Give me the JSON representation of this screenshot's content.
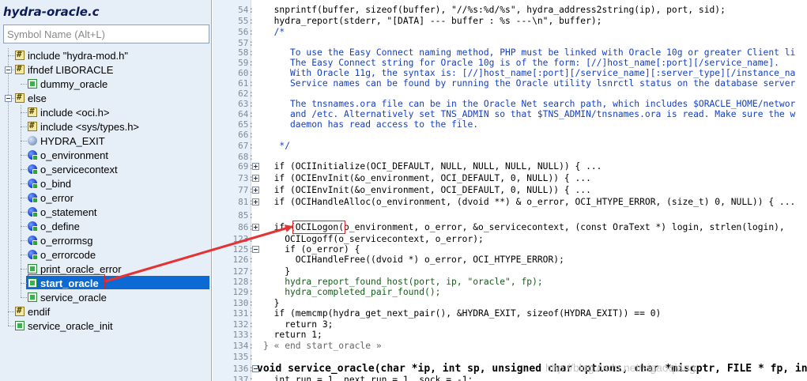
{
  "sidebar": {
    "file_title": "hydra-oracle.c",
    "search_placeholder": "Symbol Name (Alt+L)",
    "items": [
      {
        "label": "include \"hydra-mod.h\"",
        "icon": "include-icon"
      },
      {
        "label": "ifndef LIBORACLE",
        "icon": "conditional-icon"
      },
      {
        "label": "dummy_oracle",
        "icon": "function-icon"
      },
      {
        "label": "else",
        "icon": "conditional-icon"
      },
      {
        "label": "include <oci.h>",
        "icon": "include-icon"
      },
      {
        "label": "include <sys/types.h>",
        "icon": "include-icon"
      },
      {
        "label": "HYDRA_EXIT",
        "icon": "macro-icon"
      },
      {
        "label": "o_environment",
        "icon": "variable-icon"
      },
      {
        "label": "o_servicecontext",
        "icon": "variable-icon"
      },
      {
        "label": "o_bind",
        "icon": "variable-icon"
      },
      {
        "label": "o_error",
        "icon": "variable-icon"
      },
      {
        "label": "o_statement",
        "icon": "variable-icon"
      },
      {
        "label": "o_define",
        "icon": "variable-icon"
      },
      {
        "label": "o_errormsg",
        "icon": "variable-icon"
      },
      {
        "label": "o_errorcode",
        "icon": "variable-icon"
      },
      {
        "label": "print_oracle_error",
        "icon": "function-icon"
      },
      {
        "label": "start_oracle",
        "icon": "function-icon"
      },
      {
        "label": "service_oracle",
        "icon": "function-icon"
      },
      {
        "label": "endif",
        "icon": "conditional-icon"
      },
      {
        "label": "service_oracle_init",
        "icon": "function-icon"
      }
    ],
    "selected": "start_oracle"
  },
  "editor": {
    "lines": [
      {
        "num": "54:",
        "text": "  snprintf(buffer, sizeof(buffer), \"//%s:%d/%s\", hydra_address2string(ip), port, sid);",
        "cls": "kw"
      },
      {
        "num": "55:",
        "text": "  hydra_report(stderr, \"[DATA] --- buffer : %s ---\\n\", buffer);",
        "cls": "kw"
      },
      {
        "num": "56:",
        "text": "  /*",
        "cls": "comment"
      },
      {
        "num": "57:",
        "text": "",
        "cls": "comment"
      },
      {
        "num": "58:",
        "text": "     To use the Easy Connect naming method, PHP must be linked with Oracle 10g or greater Client li",
        "cls": "comment"
      },
      {
        "num": "59:",
        "text": "     The Easy Connect string for Oracle 10g is of the form: [//]host_name[:port][/service_name].",
        "cls": "comment"
      },
      {
        "num": "60:",
        "text": "     With Oracle 11g, the syntax is: [//]host_name[:port][/service_name][:server_type][/instance_na",
        "cls": "comment"
      },
      {
        "num": "61:",
        "text": "     Service names can be found by running the Oracle utility lsnrctl status on the database server",
        "cls": "comment"
      },
      {
        "num": "62:",
        "text": "",
        "cls": "comment"
      },
      {
        "num": "63:",
        "text": "     The tnsnames.ora file can be in the Oracle Net search path, which includes $ORACLE_HOME/networ",
        "cls": "comment"
      },
      {
        "num": "64:",
        "text": "     and /etc. Alternatively set TNS_ADMIN so that $TNS_ADMIN/tnsnames.ora is read. Make sure the w",
        "cls": "comment"
      },
      {
        "num": "65:",
        "text": "     daemon has read access to the file.",
        "cls": "comment"
      },
      {
        "num": "66:",
        "text": "",
        "cls": "comment"
      },
      {
        "num": "67:",
        "text": "   */",
        "cls": "comment"
      },
      {
        "num": "68:",
        "text": "",
        "cls": "kw"
      },
      {
        "num": "69:",
        "text": "  if (OCIInitialize(OCI_DEFAULT, NULL, NULL, NULL, NULL)) { ...",
        "cls": "kw",
        "fold": "plus"
      },
      {
        "num": "73:",
        "text": "  if (OCIEnvInit(&o_environment, OCI_DEFAULT, 0, NULL)) { ...",
        "cls": "kw",
        "fold": "plus"
      },
      {
        "num": "77:",
        "text": "  if (OCIEnvInit(&o_environment, OCI_DEFAULT, 0, NULL)) { ...",
        "cls": "kw",
        "fold": "plus"
      },
      {
        "num": "81:",
        "text": "  if (OCIHandleAlloc(o_environment, (dvoid **) & o_error, OCI_HTYPE_ERROR, (size_t) 0, NULL)) { ...",
        "cls": "kw",
        "fold": "plus"
      },
      {
        "num": "85:",
        "text": "",
        "cls": "kw"
      },
      {
        "num": "86:",
        "text": "  if (OCILogon(o_environment, o_error, &o_servicecontext, (const OraText *) login, strlen(login),",
        "cls": "kw",
        "fold": "plus"
      },
      {
        "num": "123:",
        "text": "    OCILogoff(o_servicecontext, o_error);",
        "cls": "kw"
      },
      {
        "num": "125:",
        "text": "    if (o_error) {",
        "cls": "kw",
        "fold": "minus"
      },
      {
        "num": "126:",
        "text": "      OCIHandleFree((dvoid *) o_error, OCI_HTYPE_ERROR);",
        "cls": "kw"
      },
      {
        "num": "127:",
        "text": "    }",
        "cls": "kw"
      },
      {
        "num": "128:",
        "text": "    hydra_report_found_host(port, ip, \"oracle\", fp);",
        "cls": "fn"
      },
      {
        "num": "129:",
        "text": "    hydra_completed_pair_found();",
        "cls": "fn"
      },
      {
        "num": "130:",
        "text": "  }",
        "cls": "kw"
      },
      {
        "num": "131:",
        "text": "  if (memcmp(hydra_get_next_pair(), &HYDRA_EXIT, sizeof(HYDRA_EXIT)) == 0)",
        "cls": "kw"
      },
      {
        "num": "132:",
        "text": "    return 3;",
        "cls": "kw"
      },
      {
        "num": "133:",
        "text": "  return 1;",
        "cls": "kw"
      },
      {
        "num": "134:",
        "text": "} « end start_oracle »",
        "cls": "endmark"
      },
      {
        "num": "135:",
        "text": "",
        "cls": "kw"
      },
      {
        "num": "136:",
        "text": "void service_oracle(char *ip, int sp, unsigned char options, char *miscptr, FILE * fp, int port",
        "cls": "kw",
        "fold": "minus"
      },
      {
        "num": "137:",
        "text": "  int run = 1, next_run = 1, sock = -1;",
        "cls": "kw"
      }
    ],
    "watermark": "http://blog.csdn.net/sigaoqiang"
  }
}
